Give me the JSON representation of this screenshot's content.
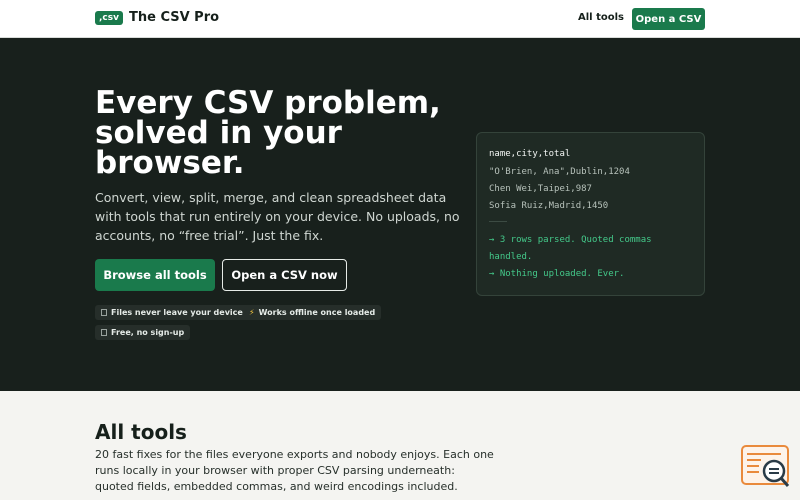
{
  "header": {
    "logo_text": ",csv",
    "brand_name": "The CSV Pro",
    "nav_all_tools": "All tools",
    "nav_open_csv": "Open a CSV"
  },
  "hero": {
    "title": "Every CSV problem, solved in your browser.",
    "subtitle": "Convert, view, split, merge, and clean spreadsheet data with tools that run entirely on your device. No uploads, no accounts, no “free trial”. Just the fix.",
    "primary_button": "Browse all tools",
    "secondary_button": "Open a CSV now",
    "badges": [
      "Files never leave your device",
      "Works offline once loaded",
      "Free, no sign-up"
    ]
  },
  "terminal": {
    "header": "name,city,total",
    "rows": [
      "\"O'Brien, Ana\",Dublin,1204",
      "Chen Wei,Taipei,987",
      "Sofia Ruiz,Madrid,1450"
    ],
    "output_line1": "→ 3 rows parsed. Quoted commas",
    "output_line2": "handled.",
    "output_line3": "→ Nothing uploaded. Ever."
  },
  "tools_section": {
    "title": "All tools",
    "description": "20 fast fixes for the files everyone exports and nobody enjoys. Each one runs locally in your browser with proper CSV parsing underneath: quoted fields, embedded commas, and weird encodings included."
  },
  "colors": {
    "accent": "#1a7a4c",
    "hero_bg": "#18201c",
    "terminal_ok": "#44c98a",
    "widget": "#e98a3c"
  }
}
